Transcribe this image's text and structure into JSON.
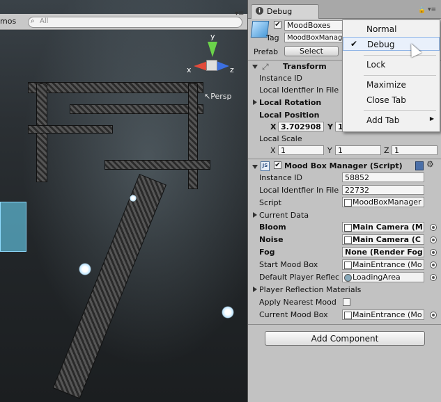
{
  "scene": {
    "gizmos_label": "mos",
    "search_placeholder": "All",
    "persp_label": "Persp",
    "axis_labels": {
      "x": "x",
      "y": "y",
      "z": "z"
    }
  },
  "tab": {
    "title": "Debug"
  },
  "gameobject": {
    "name": "MoodBoxes",
    "tag_label": "Tag",
    "tag_value": "MoodBoxManag",
    "prefab_label": "Prefab",
    "select_button": "Select"
  },
  "transform": {
    "title": "Transform",
    "instance_id_label": "Instance ID",
    "local_identifier_label": "Local Identfier In File",
    "local_rotation_label": "Local Rotation",
    "local_position_label": "Local Position",
    "position": {
      "x": "3.702908",
      "y": "1"
    },
    "local_scale_label": "Local Scale",
    "scale": {
      "x": "1",
      "y": "1",
      "z": "1"
    }
  },
  "mood_box_manager": {
    "title": "Mood Box Manager (Script)",
    "instance_id_label": "Instance ID",
    "instance_id": "58852",
    "local_identifier_label": "Local Identfier In File",
    "local_identifier": "22732",
    "script_label": "Script",
    "script_value": "MoodBoxManager",
    "current_data_label": "Current Data",
    "bloom_label": "Bloom",
    "bloom_value": "Main Camera (M",
    "noise_label": "Noise",
    "noise_value": "Main Camera (C",
    "fog_label": "Fog",
    "fog_value": "None (Render Fog",
    "start_mood_box_label": "Start Mood Box",
    "start_mood_box_value": "MainEntrance (Mo",
    "default_player_reflection_label": "Default Player Reflec",
    "default_player_reflection_value": "LoadingArea",
    "player_reflection_materials_label": "Player Reflection Materials",
    "apply_nearest_mood_label": "Apply Nearest Mood",
    "current_mood_box_label": "Current Mood Box",
    "current_mood_box_value": "MainEntrance (Mo"
  },
  "add_component_button": "Add Component",
  "context_menu": {
    "items": [
      "Normal",
      "Debug",
      "Lock",
      "Maximize",
      "Close Tab",
      "Add Tab"
    ],
    "checked": "Debug",
    "highlighted": "Debug"
  },
  "xyz_labels": {
    "x": "X",
    "y": "Y",
    "z": "Z"
  }
}
